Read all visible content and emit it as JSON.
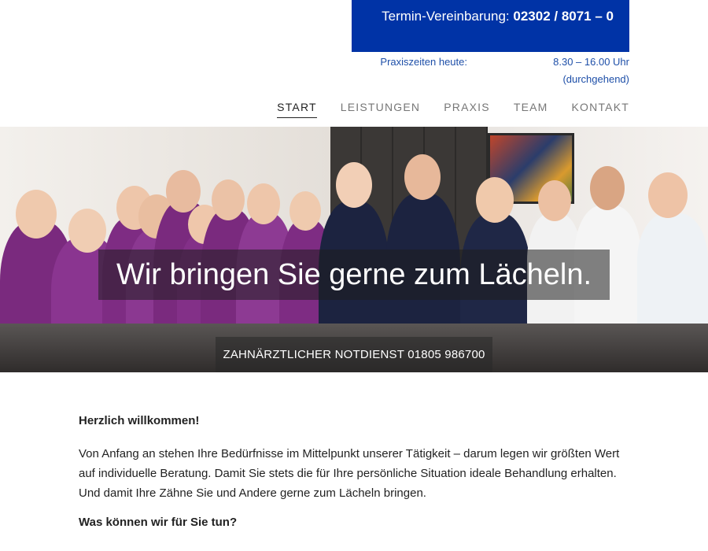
{
  "header": {
    "appointment_label": "Termin-Vereinbarung:",
    "appointment_number": "02302 / 8071 – 0",
    "hours_label": "Praxiszeiten heute:",
    "hours_value": "8.30 – 16.00 Uhr (durchgehend)"
  },
  "nav": {
    "items": [
      {
        "label": "START",
        "active": true
      },
      {
        "label": "LEISTUNGEN",
        "active": false
      },
      {
        "label": "PRAXIS",
        "active": false
      },
      {
        "label": "TEAM",
        "active": false
      },
      {
        "label": "KONTAKT",
        "active": false
      }
    ]
  },
  "hero": {
    "title": "Wir bringen Sie gerne zum Lächeln.",
    "emergency": "ZAHNÄRZTLICHER NOTDIENST 01805 986700"
  },
  "content": {
    "welcome_heading": "Herzlich willkommen!",
    "intro": "Von Anfang an stehen Ihre Bedürfnisse im Mittelpunkt unserer Tätigkeit – darum legen wir größten Wert auf individuelle Beratung. Damit Sie stets die für Ihre persönliche Situation ideale Behandlung erhalten. Und damit Ihre Zähne Sie und Andere gerne zum Lächeln bringen.",
    "second_heading": "Was können wir für Sie tun?"
  },
  "colors": {
    "brand_blue": "#0033a6",
    "link_blue": "#1e4fa8",
    "team_purple": "#7a2a7e",
    "team_navy": "#1c2340"
  }
}
